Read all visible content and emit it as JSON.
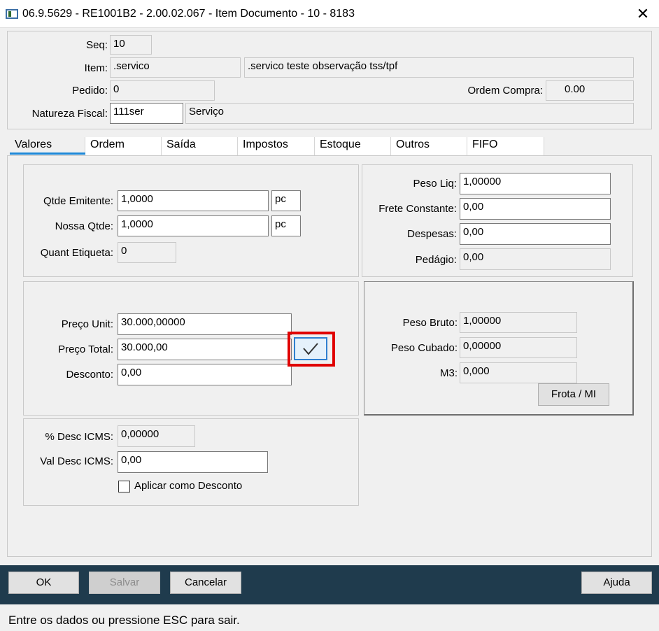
{
  "window": {
    "title": "06.9.5629 - RE1001B2 - 2.00.02.067 - Item Documento - 10 - 8183",
    "close": "✕"
  },
  "header": {
    "seq_label": "Seq:",
    "seq_value": "10",
    "item_label": "Item:",
    "item_code": ".servico",
    "item_desc": ".servico teste observação tss/tpf",
    "pedido_label": "Pedido:",
    "pedido_value": "0",
    "ordem_compra_label": "Ordem Compra:",
    "ordem_compra_value": "0.00",
    "natureza_label": "Natureza Fiscal:",
    "natureza_code": "111ser",
    "natureza_desc": "Serviço"
  },
  "tabs": [
    {
      "label": "Valores"
    },
    {
      "label": "Ordem"
    },
    {
      "label": "Saída"
    },
    {
      "label": "Impostos"
    },
    {
      "label": "Estoque"
    },
    {
      "label": "Outros"
    },
    {
      "label": "FIFO"
    }
  ],
  "quantidades": {
    "qtde_emitente_label": "Qtde Emitente:",
    "qtde_emitente_value": "1,0000",
    "qtde_emitente_unit": "pc",
    "nossa_qtde_label": "Nossa Qtde:",
    "nossa_qtde_value": "1,0000",
    "nossa_qtde_unit": "pc",
    "quant_etiqueta_label": "Quant Etiqueta:",
    "quant_etiqueta_value": "0"
  },
  "pesos": {
    "peso_liq_label": "Peso Liq:",
    "peso_liq_value": "1,00000",
    "frete_label": "Frete Constante:",
    "frete_value": "0,00",
    "despesas_label": "Despesas:",
    "despesas_value": "0,00",
    "pedagio_label": "Pedágio:",
    "pedagio_value": "0,00"
  },
  "precos": {
    "preco_unit_label": "Preço Unit:",
    "preco_unit_value": "30.000,00000",
    "preco_total_label": "Preço Total:",
    "preco_total_value": "30.000,00",
    "desconto_label": "Desconto:",
    "desconto_value": "0,00"
  },
  "peso_bruto": {
    "peso_bruto_label": "Peso Bruto:",
    "peso_bruto_value": "1,00000",
    "peso_cubado_label": "Peso Cubado:",
    "peso_cubado_value": "0,00000",
    "m3_label": "M3:",
    "m3_value": "0,000",
    "frota_button": "Frota / MI"
  },
  "icms": {
    "desc_icms_label": "% Desc ICMS:",
    "desc_icms_value": "0,00000",
    "val_desc_label": "Val Desc ICMS:",
    "val_desc_value": "0,00",
    "aplicar_label": "Aplicar como Desconto"
  },
  "footer": {
    "ok": "OK",
    "salvar": "Salvar",
    "cancelar": "Cancelar",
    "ajuda": "Ajuda"
  },
  "status": {
    "text": "Entre os dados ou pressione ESC para sair."
  },
  "colors": {
    "footer_bar": "#1f3b4d",
    "highlight": "#e00000",
    "tab_accent": "#1e88d8",
    "check_border": "#2f7fd0"
  }
}
